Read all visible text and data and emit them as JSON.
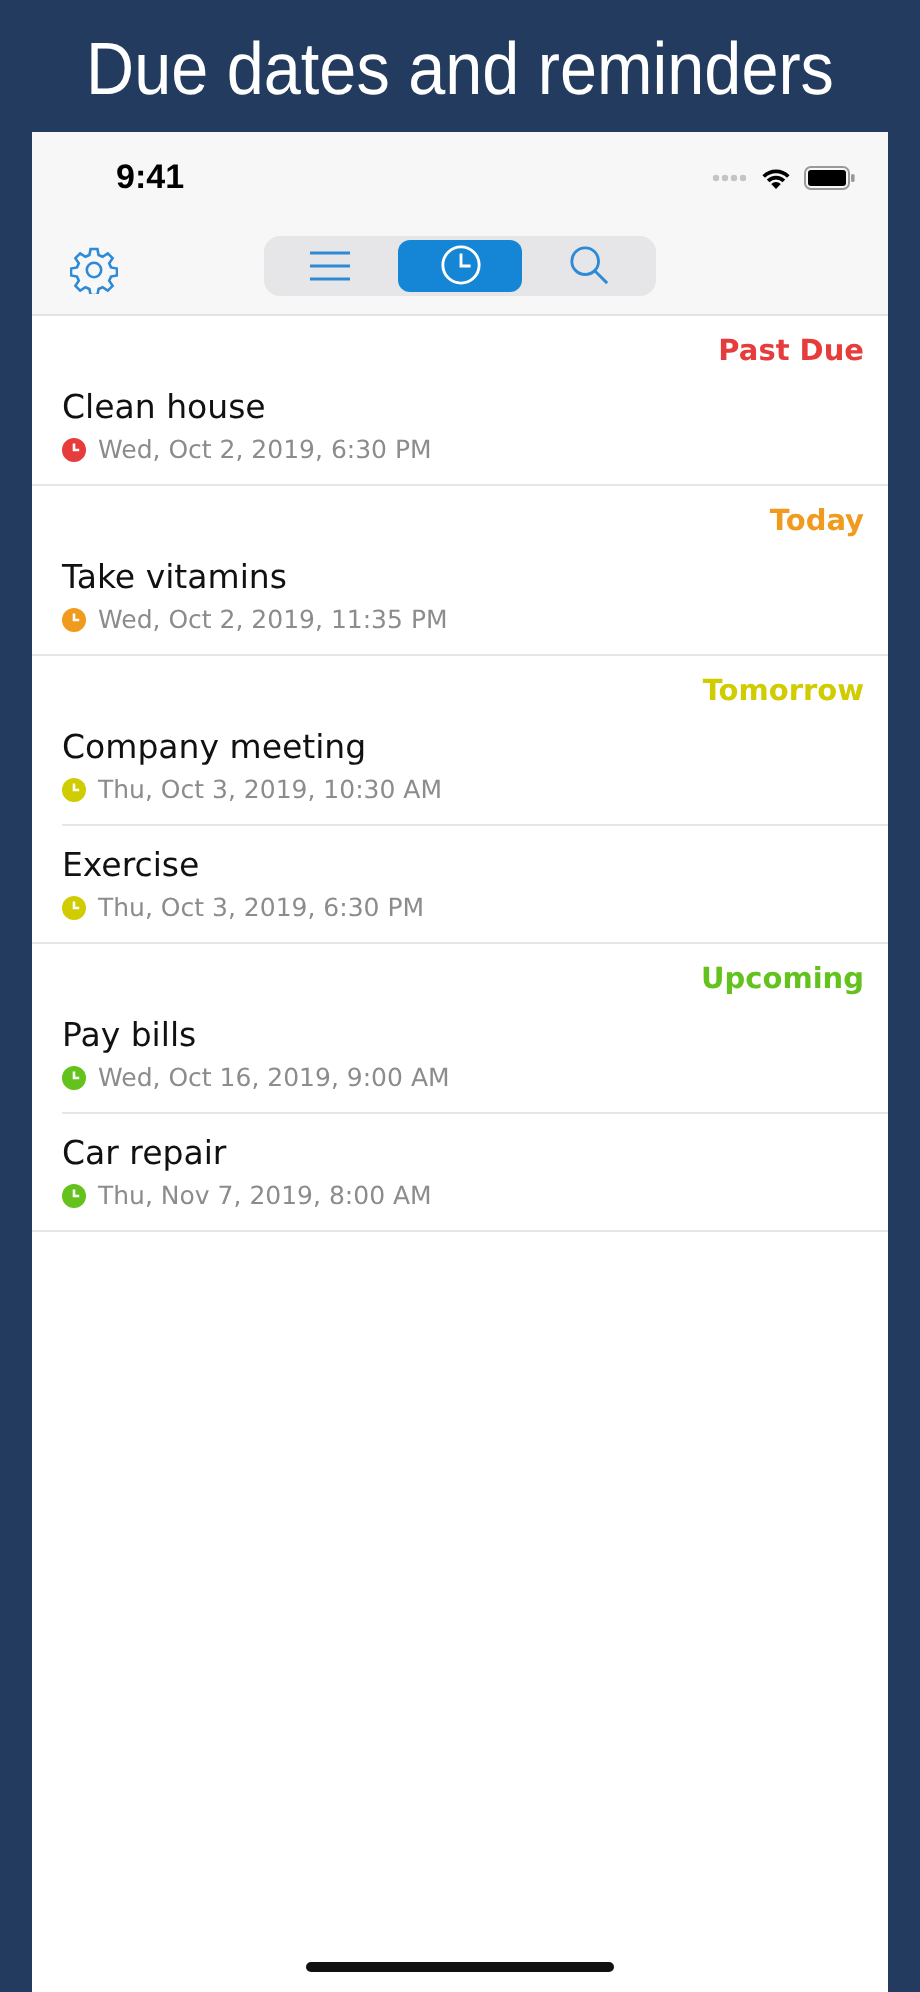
{
  "headline": "Due dates and reminders",
  "status_bar": {
    "time": "9:41"
  },
  "segments": [
    {
      "kind": "list",
      "selected": false
    },
    {
      "kind": "clock",
      "selected": true
    },
    {
      "kind": "search",
      "selected": false
    }
  ],
  "sections": [
    {
      "title": "Past Due",
      "color": "#e63c3c",
      "items": [
        {
          "title": "Clean house",
          "due": "Wed, Oct 2, 2019, 6:30 PM"
        }
      ]
    },
    {
      "title": "Today",
      "color": "#f09a1e",
      "items": [
        {
          "title": "Take vitamins",
          "due": "Wed, Oct 2, 2019, 11:35 PM"
        }
      ]
    },
    {
      "title": "Tomorrow",
      "color": "#cfcc00",
      "items": [
        {
          "title": "Company meeting",
          "due": "Thu, Oct 3, 2019, 10:30 AM"
        },
        {
          "title": "Exercise",
          "due": "Thu, Oct 3, 2019, 6:30 PM"
        }
      ]
    },
    {
      "title": "Upcoming",
      "color": "#63c21c",
      "items": [
        {
          "title": "Pay bills",
          "due": "Wed, Oct 16, 2019, 9:00 AM"
        },
        {
          "title": "Car repair",
          "due": "Thu, Nov 7, 2019, 8:00 AM"
        }
      ]
    }
  ]
}
